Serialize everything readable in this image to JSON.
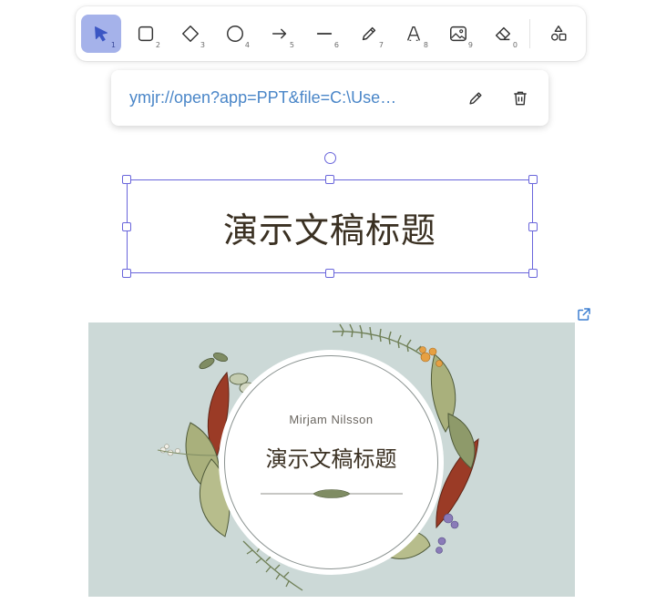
{
  "toolbar": {
    "tools": [
      {
        "name": "selection",
        "icon": "pointer-icon",
        "key": "1",
        "active": true
      },
      {
        "name": "rectangle",
        "icon": "square-icon",
        "key": "2"
      },
      {
        "name": "diamond",
        "icon": "diamond-icon",
        "key": "3"
      },
      {
        "name": "ellipse",
        "icon": "circle-icon",
        "key": "4"
      },
      {
        "name": "arrow",
        "icon": "arrow-right-icon",
        "key": "5"
      },
      {
        "name": "line",
        "icon": "line-icon",
        "key": "6"
      },
      {
        "name": "draw",
        "icon": "pencil-icon",
        "key": "7"
      },
      {
        "name": "text",
        "icon": "text-icon",
        "key": "8"
      },
      {
        "name": "image",
        "icon": "image-icon",
        "key": "9"
      },
      {
        "name": "eraser",
        "icon": "eraser-icon",
        "key": "0"
      },
      {
        "name": "more-shapes",
        "icon": "shapes-icon",
        "key": ""
      }
    ],
    "accent": "#a5b2ea"
  },
  "link_popup": {
    "url": "ymjr://open?app=PPT&file=C:\\Use…",
    "edit_icon": "pencil-icon",
    "delete_icon": "trash-icon"
  },
  "selected_element": {
    "text": "演示文稿标题",
    "selection_color": "#6965db"
  },
  "embed": {
    "external_link_icon": "external-link-icon",
    "slide": {
      "author": "Mirjam Nilsson",
      "title": "演示文稿标题",
      "background": "#ccd9d7"
    }
  }
}
